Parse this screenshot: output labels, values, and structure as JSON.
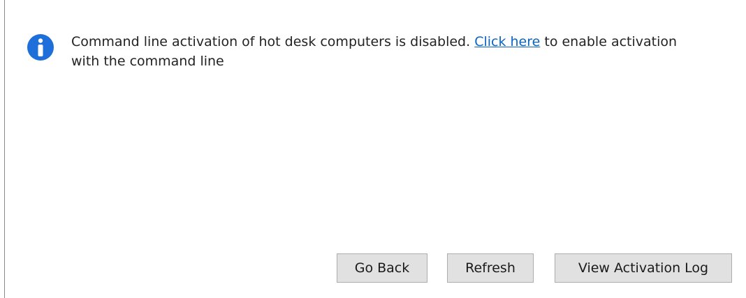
{
  "message": {
    "icon": "info-icon",
    "text_before": "Command line activation of hot desk computers is disabled. ",
    "link_text": "Click here",
    "text_after": " to enable activation with the command line"
  },
  "buttons": {
    "go_back": "Go Back",
    "refresh": "Refresh",
    "view_log": "View Activation Log"
  },
  "colors": {
    "icon": "#1e6fd9",
    "link": "#0b63c5",
    "button_bg": "#e1e1e1",
    "button_border": "#adadad"
  }
}
